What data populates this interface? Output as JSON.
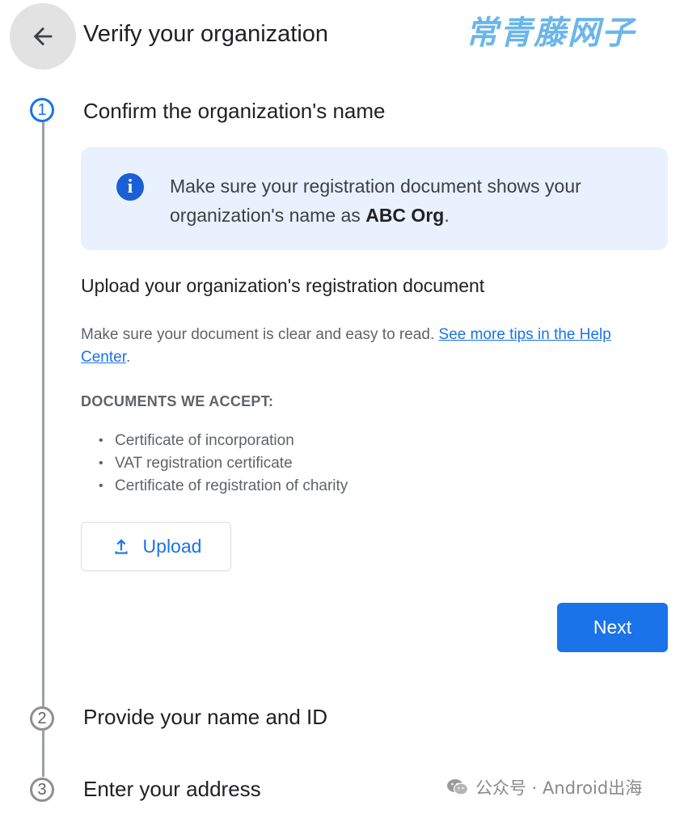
{
  "header": {
    "back_icon": "arrow-left-icon",
    "title": "Verify your organization",
    "watermark": "常青藤网子"
  },
  "steps": [
    {
      "number": "1",
      "title": "Confirm the organization's name",
      "state": "active"
    },
    {
      "number": "2",
      "title": "Provide your name and ID",
      "state": "inactive"
    },
    {
      "number": "3",
      "title": "Enter your address",
      "state": "inactive"
    }
  ],
  "info": {
    "icon": "info-icon",
    "glyph": "i",
    "text_before": "Make sure your registration document shows your organization's name as ",
    "org_name": "ABC Org",
    "text_after": "."
  },
  "upload_section": {
    "heading": "Upload your organization's registration document",
    "help_text": "Make sure your document is clear and easy to read. ",
    "help_link": "See more tips in the Help Center",
    "help_after": ".",
    "docs_heading": "DOCUMENTS WE ACCEPT:",
    "docs": [
      "Certificate of incorporation",
      "VAT registration certificate",
      "Certificate of registration of charity"
    ],
    "upload_label": "Upload",
    "upload_icon": "upload-icon"
  },
  "actions": {
    "next_label": "Next"
  },
  "footer_watermark": {
    "icon": "wechat-icon",
    "text": "公众号 · Android出海"
  },
  "colors": {
    "accent": "#1a73e8",
    "info_bg": "#e8f1fd",
    "info_icon": "#1a5fd6",
    "step_line": "#9aa0a6"
  }
}
